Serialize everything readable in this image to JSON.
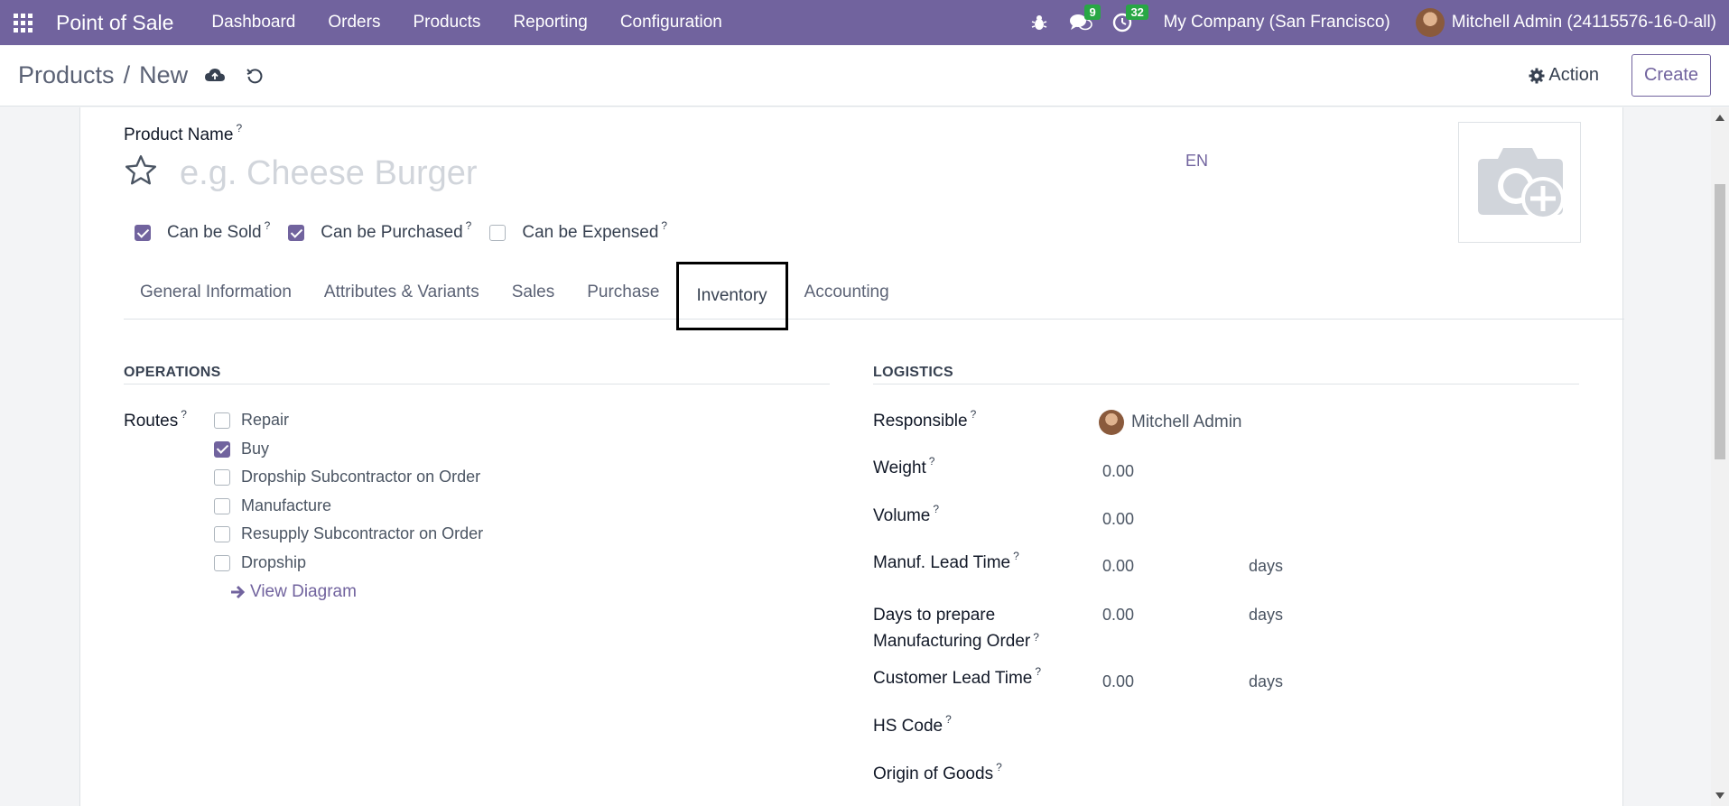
{
  "navbar": {
    "app_title": "Point of Sale",
    "menu": [
      "Dashboard",
      "Orders",
      "Products",
      "Reporting",
      "Configuration"
    ],
    "messages_count": "9",
    "activities_count": "32",
    "company": "My Company (San Francisco)",
    "user": "Mitchell Admin (24115576-16-0-all)"
  },
  "control": {
    "breadcrumb_parent": "Products",
    "breadcrumb_separator": "/",
    "breadcrumb_current": "New",
    "action_label": "Action",
    "create_label": "Create"
  },
  "form": {
    "product_name_label": "Product Name",
    "product_name_placeholder": "e.g. Cheese Burger",
    "language": "EN",
    "help_mark": "?",
    "options": [
      {
        "label": "Can be Sold",
        "checked": true
      },
      {
        "label": "Can be Purchased",
        "checked": true
      },
      {
        "label": "Can be Expensed",
        "checked": false
      }
    ],
    "tabs": [
      "General Information",
      "Attributes & Variants",
      "Sales",
      "Purchase",
      "Inventory",
      "Accounting"
    ],
    "active_tab": "Inventory"
  },
  "operations": {
    "title": "OPERATIONS",
    "routes_label": "Routes",
    "routes": [
      {
        "label": "Repair",
        "checked": false
      },
      {
        "label": "Buy",
        "checked": true
      },
      {
        "label": "Dropship Subcontractor on Order",
        "checked": false
      },
      {
        "label": "Manufacture",
        "checked": false
      },
      {
        "label": "Resupply Subcontractor on Order",
        "checked": false
      },
      {
        "label": "Dropship",
        "checked": false
      }
    ],
    "view_diagram": "View Diagram"
  },
  "logistics": {
    "title": "LOGISTICS",
    "responsible_label": "Responsible",
    "responsible_value": "Mitchell Admin",
    "weight_label": "Weight",
    "weight_value": "0.00",
    "volume_label": "Volume",
    "volume_value": "0.00",
    "manuf_label": "Manuf. Lead Time",
    "manuf_value": "0.00",
    "prep_label_line1": "Days to prepare",
    "prep_label_line2": "Manufacturing Order",
    "prep_value": "0.00",
    "customer_label": "Customer Lead Time",
    "customer_value": "0.00",
    "days_unit": "days",
    "hs_label": "HS Code",
    "origin_label": "Origin of Goods"
  },
  "colors": {
    "brand": "#71639e",
    "badge": "#28a745"
  }
}
